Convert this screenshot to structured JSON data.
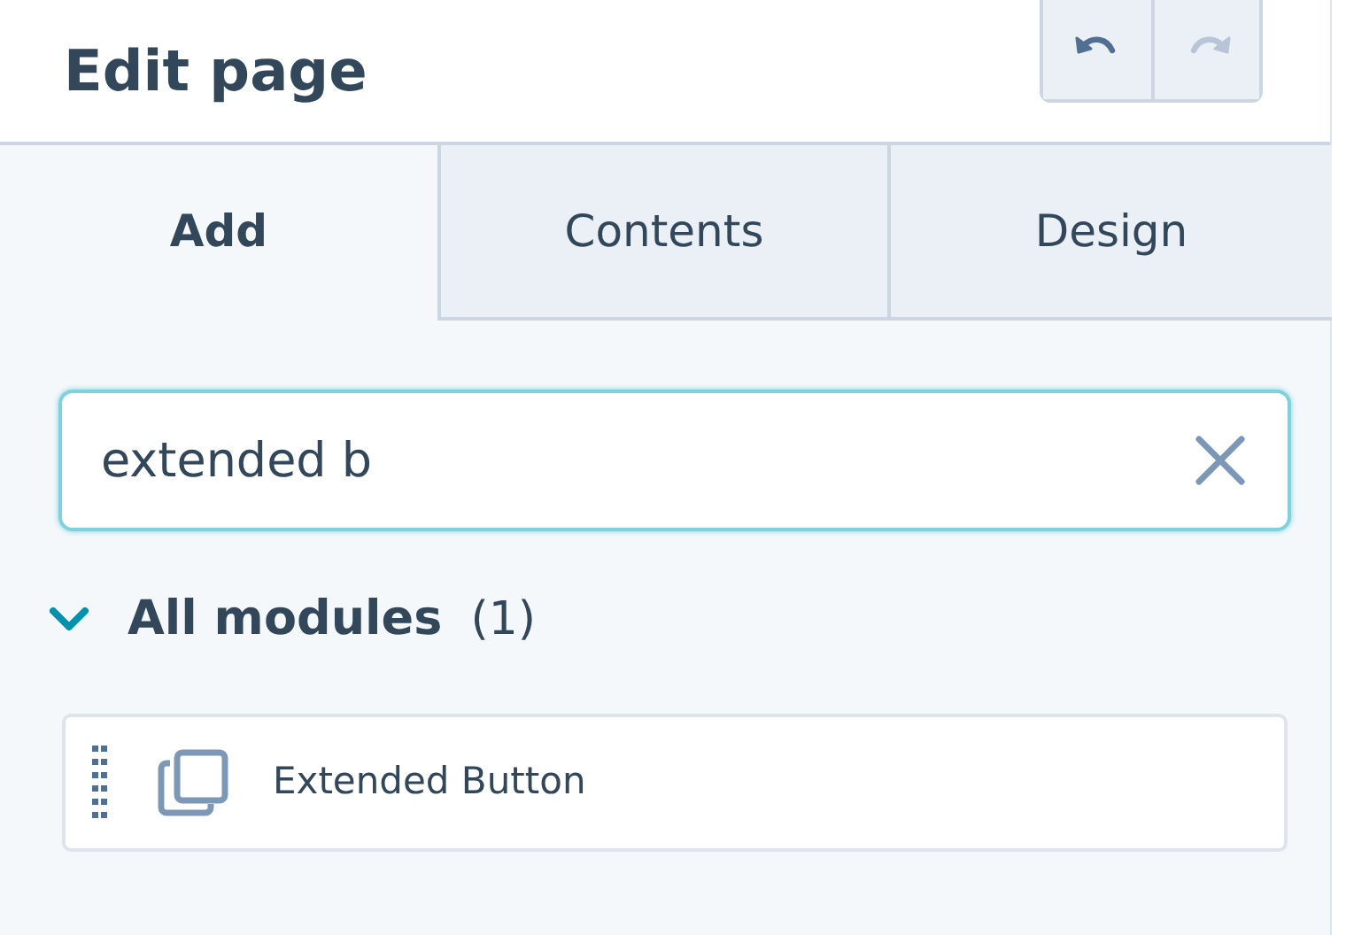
{
  "header": {
    "title": "Edit page"
  },
  "history_buttons": [
    {
      "kind": "undo",
      "disabled": false
    },
    {
      "kind": "redo",
      "disabled": true
    }
  ],
  "tabs": [
    {
      "label": "Add",
      "selected": true
    },
    {
      "label": "Contents",
      "selected": false
    },
    {
      "label": "Design",
      "selected": false
    }
  ],
  "search": {
    "value": "extended b"
  },
  "section": {
    "label": "All modules",
    "count": "(1)",
    "expanded": true,
    "modules": [
      {
        "label": "Extended Button"
      }
    ]
  }
}
